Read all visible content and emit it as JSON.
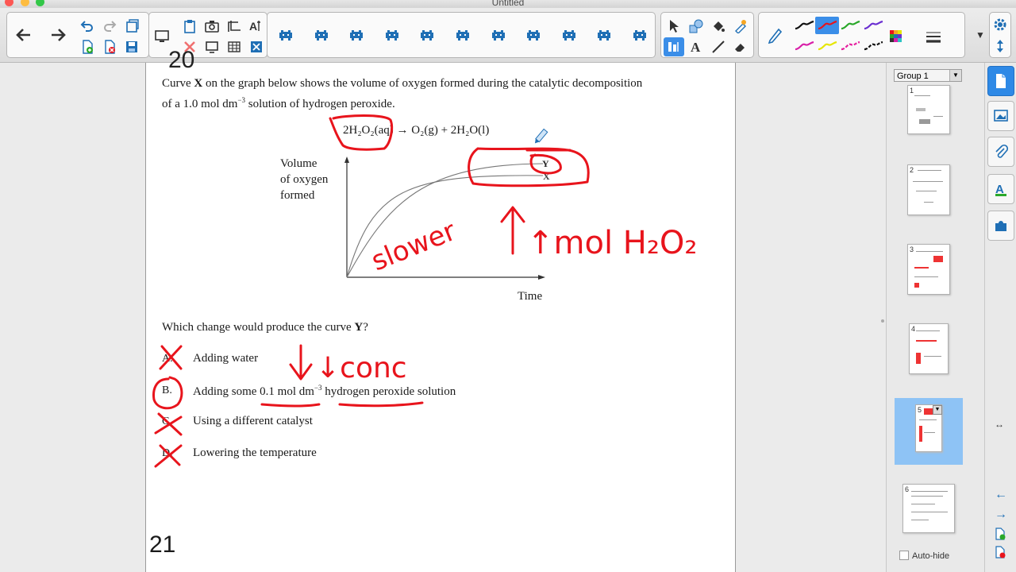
{
  "window": {
    "title": "Untitled"
  },
  "colors": {
    "accent": "#3b8ee8",
    "ink_red": "#e8141c",
    "toolbar_blue": "#1f6fb5"
  },
  "toolbar": {
    "nav_back_icon": "arrow-left-icon",
    "nav_forward_icon": "arrow-right-icon",
    "page_icons": [
      "undo-icon",
      "redo-icon",
      "insert-page-icon",
      "add-page-icon",
      "delete-page-icon",
      "save-icon"
    ],
    "display_icons": [
      "screen-shade-icon",
      "paste-icon",
      "camera-icon",
      "capture-icon",
      "spellcheck-icon",
      "delete-icon",
      "fullscreen-icon",
      "table-icon",
      "close-box-icon"
    ],
    "addon_icon_count_label": "",
    "tools": [
      "select-icon",
      "shapes-icon",
      "fill-icon",
      "eraser-pen-icon",
      "measure-icon",
      "text-icon",
      "line-icon",
      "eraser-icon"
    ],
    "pen_colors": [
      "#111111",
      "#e8141c",
      "#2aa82a",
      "#6b2fd1",
      "#d81fa8",
      "#e6e600",
      "#e61f9f",
      "#111111"
    ]
  },
  "document": {
    "top_fragment": "20",
    "question": {
      "line1_a": "Curve ",
      "line1_bold": "X",
      "line1_b": " on the graph below shows the volume of oxygen formed during the catalytic decomposition",
      "line2_a": "of a 1.0 mol dm",
      "line2_sup": "−3",
      "line2_b": " solution of hydrogen peroxide."
    },
    "equation": "2H₂O₂(aq) → O₂(g) + 2H₂O(l)",
    "graph": {
      "ylabel": [
        "Volume",
        "of oxygen",
        "formed"
      ],
      "xlabel": "Time",
      "curve_labels": {
        "y": "Y",
        "x": "X"
      }
    },
    "prompt_a": "Which change would produce the curve ",
    "prompt_bold": "Y",
    "prompt_b": "?",
    "options": [
      {
        "letter": "A.",
        "text": "Adding water"
      },
      {
        "letter": "B.",
        "text_a": "Adding some 0.1 mol dm",
        "sup": "−3",
        "text_b": " hydrogen peroxide solution"
      },
      {
        "letter": "C.",
        "text": "Using a different catalyst"
      },
      {
        "letter": "D.",
        "text": "Lowering the temperature"
      }
    ],
    "page_number": "21",
    "handwriting": {
      "slower": "slower",
      "more_h2o2": "↑mol H₂O₂",
      "less_conc": "↓conc"
    }
  },
  "sidebar": {
    "group": "Group 1",
    "pages": [
      "1",
      "2",
      "3",
      "4",
      "5",
      "6"
    ],
    "selected_page": "5",
    "autohide_label": "Auto-hide"
  },
  "tabs": [
    "page-sorter-icon",
    "gallery-icon",
    "attachments-icon",
    "properties-icon",
    "add-ons-icon"
  ]
}
